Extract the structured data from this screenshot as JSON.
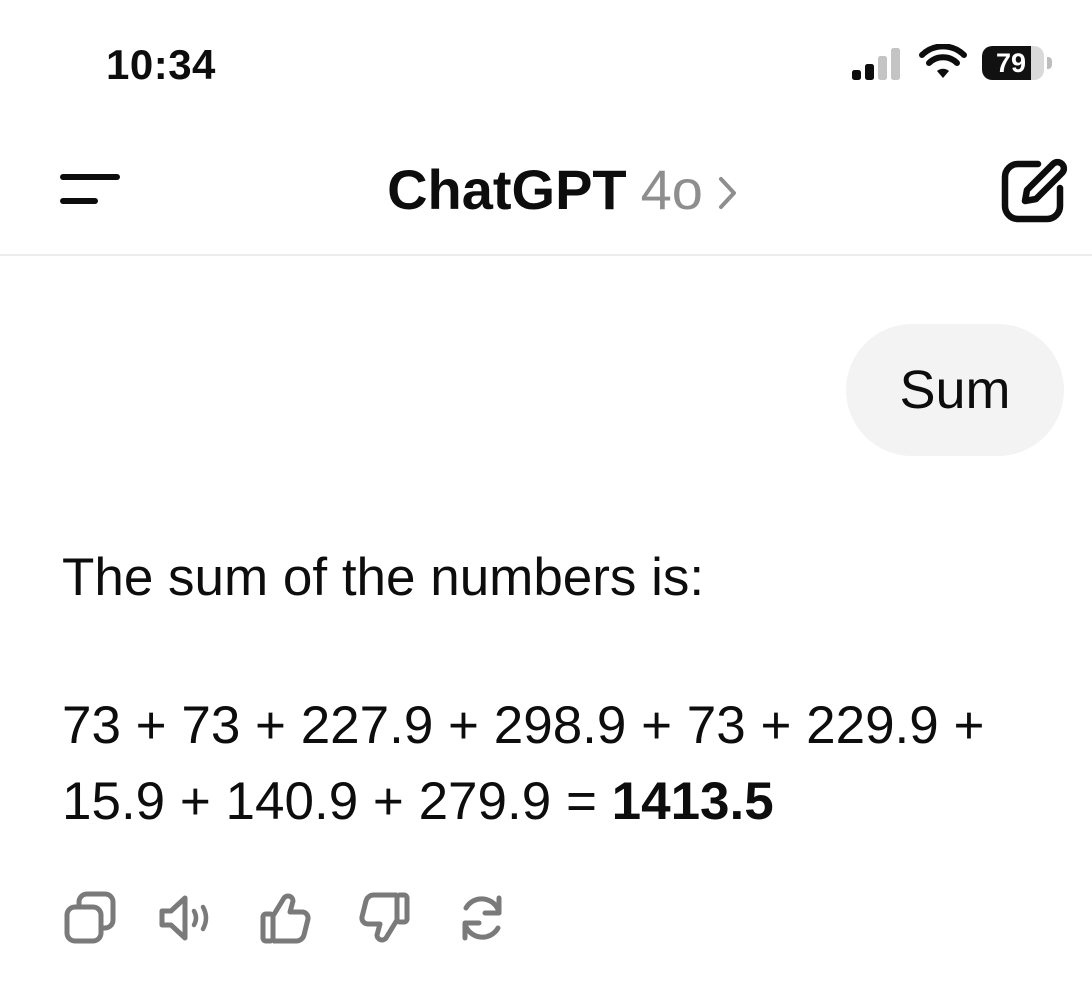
{
  "status_bar": {
    "time": "10:34",
    "battery_percent": "79",
    "battery_level": 0.79,
    "signal_bars_active": 2,
    "signal_bars_total": 4
  },
  "header": {
    "title": "ChatGPT",
    "model": "4o",
    "menu_icon": "menu-icon",
    "new_chat_icon": "edit-icon"
  },
  "conversation": {
    "user_message": "Sum",
    "assistant_intro": "The sum of the numbers is:",
    "equation_terms": "73 + 73 + 227.9 + 298.9 + 73 + 229.9 + 15.9 + 140.9 + 279.9 = ",
    "equation_result": "1413.5"
  },
  "actions": [
    "copy-icon",
    "read-aloud-icon",
    "thumbs-up-icon",
    "thumbs-down-icon",
    "regenerate-icon"
  ],
  "colors": {
    "text": "#0d0d0d",
    "muted": "#8e8e8e",
    "bubble": "#f3f3f3",
    "icon": "#7a7a7a"
  }
}
